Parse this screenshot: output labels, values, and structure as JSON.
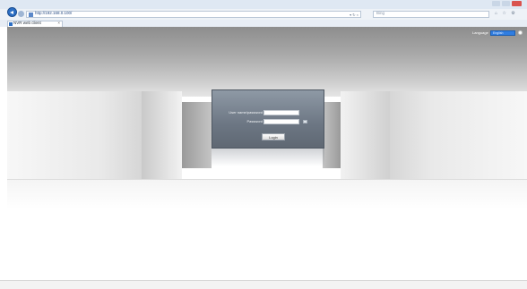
{
  "browser": {
    "address": "http://192.168.0.100/",
    "search_placeholder": "Bing",
    "tab_label": "NVR web client",
    "tab_close": "×",
    "address_controls": "▾ ↻ ×",
    "tool_icons": "⌂ ☆ ⚙"
  },
  "header": {
    "language_label": "Language",
    "language_value": "English"
  },
  "login": {
    "username_label": "User name/password",
    "password_label": "Password",
    "login_button": "Login"
  },
  "colors": {
    "accent": "#2f7de1",
    "panel": "#6c7683"
  }
}
